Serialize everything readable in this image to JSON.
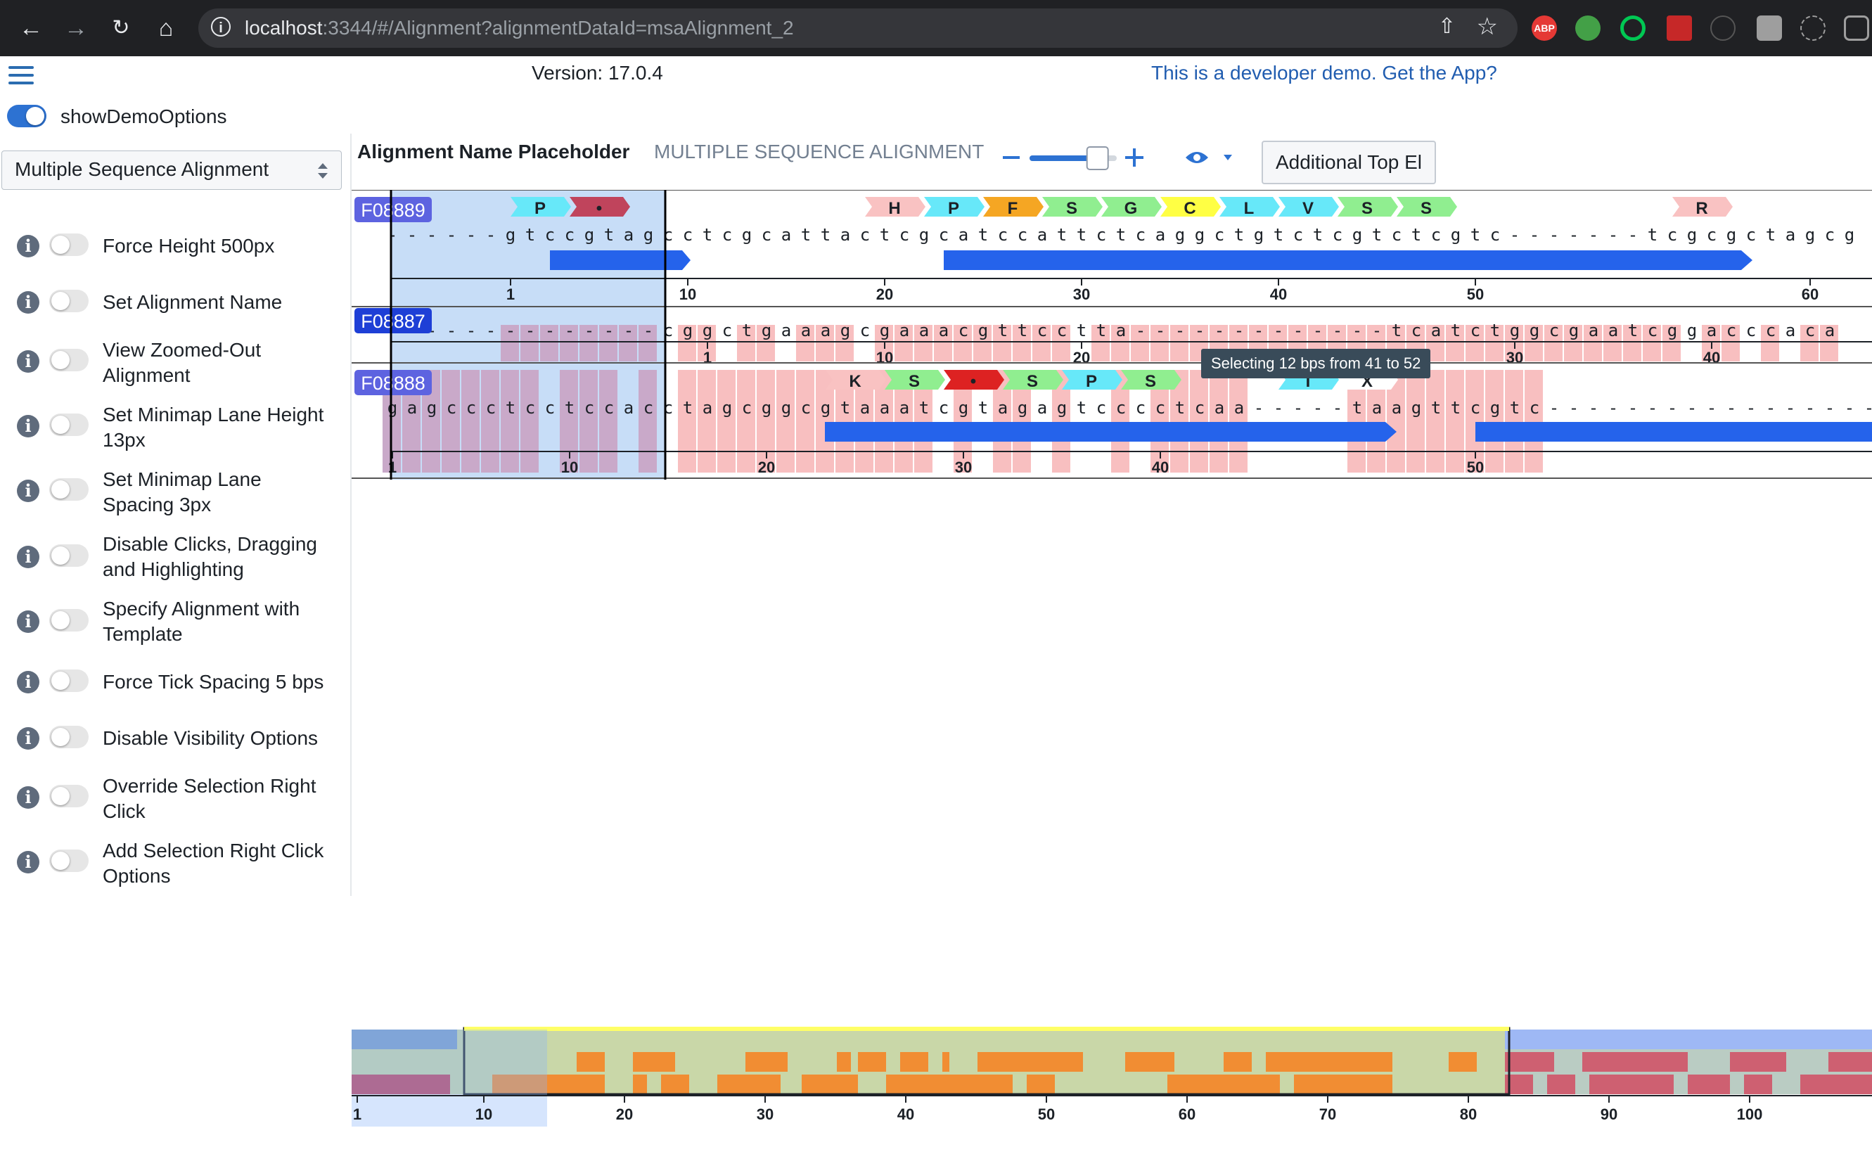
{
  "browser": {
    "url_host": "localhost",
    "url_rest": ":3344/#/Alignment?alignmentDataId=msaAlignment_2"
  },
  "header": {
    "version": "Version: 17.0.4",
    "demo_link": "This is a developer demo. Get the App?"
  },
  "demo_toggle": {
    "label": "showDemoOptions",
    "on": true
  },
  "demo_select": {
    "value": "Multiple Sequence Alignment"
  },
  "options": [
    {
      "label": "Force Height 500px",
      "on": false
    },
    {
      "label": "Set Alignment Name",
      "on": false
    },
    {
      "label": "View Zoomed-Out Alignment",
      "on": false
    },
    {
      "label": "Set Minimap Lane Height 13px",
      "on": false
    },
    {
      "label": "Set Minimap Lane Spacing 3px",
      "on": false
    },
    {
      "label": "Disable Clicks, Dragging and Highlighting",
      "on": false
    },
    {
      "label": "Specify Alignment with Template",
      "on": false
    },
    {
      "label": "Force Tick Spacing 5 bps",
      "on": false
    },
    {
      "label": "Disable Visibility Options",
      "on": false
    },
    {
      "label": "Override Selection Right Click",
      "on": false
    },
    {
      "label": "Add Selection Right Click Options",
      "on": false
    }
  ],
  "alignment": {
    "name": "Alignment Name Placeholder",
    "type": "MULTIPLE SEQUENCE ALIGNMENT",
    "zoom_fraction": 0.78,
    "top_button": "Additional Top El",
    "tooltip": "Selecting 12 bps from 41 to 52",
    "tracks": [
      {
        "name": "F08889",
        "seq": "------gtccgtagcctcgcattactcgcatccattctcaggctgtctcgtctcgtc-------tcgcgctagcg",
        "aa": [
          {
            "c": "P",
            "col": 7.5,
            "color": "#67e8f9"
          },
          {
            "c": "•",
            "col": 10.5,
            "color": "#c0445c"
          },
          {
            "c": "H",
            "col": 25.5,
            "color": "#f9c2c2"
          },
          {
            "c": "P",
            "col": 28.5,
            "color": "#67e8f9"
          },
          {
            "c": "F",
            "col": 31.5,
            "color": "#f5a623"
          },
          {
            "c": "S",
            "col": 34.5,
            "color": "#90ee90"
          },
          {
            "c": "G",
            "col": 37.5,
            "color": "#90ee90"
          },
          {
            "c": "C",
            "col": 40.5,
            "color": "#ffff44"
          },
          {
            "c": "L",
            "col": 43.5,
            "color": "#67e8f9"
          },
          {
            "c": "V",
            "col": 46.5,
            "color": "#67e8f9"
          },
          {
            "c": "S",
            "col": 49.5,
            "color": "#90ee90"
          },
          {
            "c": "S",
            "col": 52.5,
            "color": "#90ee90"
          },
          {
            "c": "R",
            "col": 66.5,
            "color": "#f9c2c2"
          }
        ],
        "ticks": [
          {
            "col": 6,
            "label": "1"
          },
          {
            "col": 15,
            "label": "10"
          },
          {
            "col": 25,
            "label": "20"
          },
          {
            "col": 35,
            "label": "30"
          },
          {
            "col": 45,
            "label": "40"
          },
          {
            "col": 55,
            "label": "50"
          },
          {
            "col": 72,
            "label": "60"
          }
        ]
      },
      {
        "name": "F08887",
        "seq": "--------------cggctgaaagcgaaacgttcctta-------------tcatctggcgaatcggacccaca",
        "ticks": [
          {
            "col": 16,
            "label": "1"
          },
          {
            "col": 25,
            "label": "10"
          },
          {
            "col": 35,
            "label": "20"
          },
          {
            "col": 57,
            "label": "30"
          },
          {
            "col": 67,
            "label": "40"
          }
        ]
      },
      {
        "name": "F08888",
        "seq": "gagccctcctccacctagcggcgtaaatcgtagagtcccctcaa-----taagttcgtc-------------------",
        "aa": [
          {
            "c": "K",
            "col": 23.5,
            "color": "#f9c2c2"
          },
          {
            "c": "S",
            "col": 26.5,
            "color": "#90ee90"
          },
          {
            "c": "•",
            "col": 29.5,
            "color": "#dd2222"
          },
          {
            "c": "S",
            "col": 32.5,
            "color": "#90ee90"
          },
          {
            "c": "P",
            "col": 35.5,
            "color": "#67e8f9"
          },
          {
            "c": "S",
            "col": 38.5,
            "color": "#90ee90"
          },
          {
            "c": "I",
            "col": 46.5,
            "color": "#67e8f9"
          },
          {
            "c": "X",
            "col": 49.5,
            "color": "#ffffff"
          }
        ],
        "ticks": [
          {
            "col": 0,
            "label": "1"
          },
          {
            "col": 9,
            "label": "10"
          },
          {
            "col": 19,
            "label": "20"
          },
          {
            "col": 29,
            "label": "30"
          },
          {
            "col": 39,
            "label": "40"
          },
          {
            "col": 55,
            "label": "50"
          }
        ]
      }
    ],
    "minimap_ticks": [
      {
        "pos": 1,
        "label": "1"
      },
      {
        "pos": 10,
        "label": "10"
      },
      {
        "pos": 20,
        "label": "20"
      },
      {
        "pos": 30,
        "label": "30"
      },
      {
        "pos": 40,
        "label": "40"
      },
      {
        "pos": 50,
        "label": "50"
      },
      {
        "pos": 60,
        "label": "60"
      },
      {
        "pos": 70,
        "label": "70"
      },
      {
        "pos": 80,
        "label": "80"
      },
      {
        "pos": 90,
        "label": "90"
      },
      {
        "pos": 100,
        "label": "100"
      }
    ]
  }
}
